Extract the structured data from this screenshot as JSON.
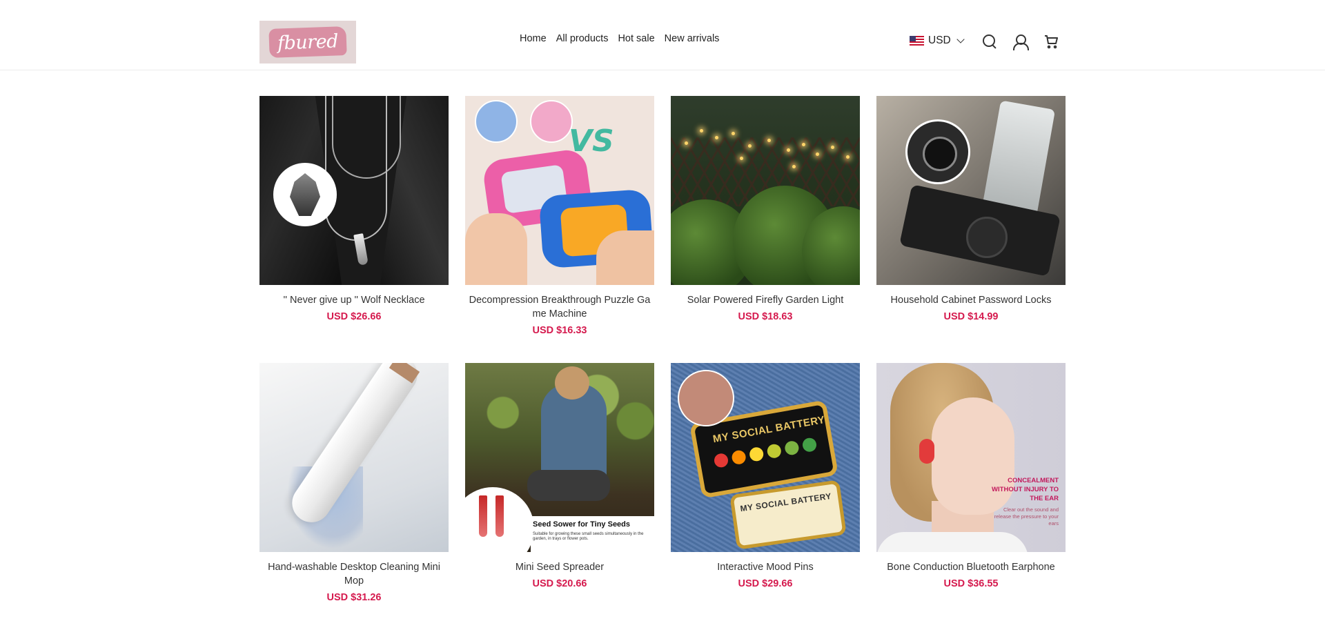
{
  "header": {
    "logo_text": "fbured",
    "nav": [
      "Home",
      "All products",
      "Hot sale",
      "New arrivals"
    ],
    "currency": "USD",
    "icons": [
      "search-icon",
      "user-icon",
      "cart-icon"
    ]
  },
  "products": [
    {
      "title": "'' Never give up '' Wolf Necklace",
      "price": "USD $26.66"
    },
    {
      "title": "Decompression Breakthrough Puzzle Ga me Machine",
      "price": "USD $16.33",
      "image_text": "VS"
    },
    {
      "title": "Solar Powered Firefly Garden Light",
      "price": "USD $18.63"
    },
    {
      "title": "Household Cabinet Password Locks",
      "price": "USD $14.99"
    },
    {
      "title": "Hand-washable Desktop Cleaning Mini Mop",
      "price": "USD $31.26"
    },
    {
      "title": "Mini Seed Spreader",
      "price": "USD $20.66",
      "image_text": "Seed Sower for Tiny Seeds",
      "image_subtext": "Suitable for growing these small seeds simultaneously in the garden, in trays or flower pots."
    },
    {
      "title": "Interactive Mood Pins",
      "price": "USD $29.66",
      "image_text": "MY SOCIAL BATTERY",
      "image_text2": "MY SOCIAL BATTERY"
    },
    {
      "title": "Bone Conduction Bluetooth Earphone",
      "price": "USD $36.55",
      "image_text": "CONCEALMENT WITHOUT INJURY TO THE EAR",
      "image_subtext": "Clear out the sound and release the pressure to your ears"
    }
  ],
  "colors": {
    "price": "#d51a4e",
    "logo_bg": "#e3d6d6",
    "logo_accent": "#d98fa3"
  }
}
